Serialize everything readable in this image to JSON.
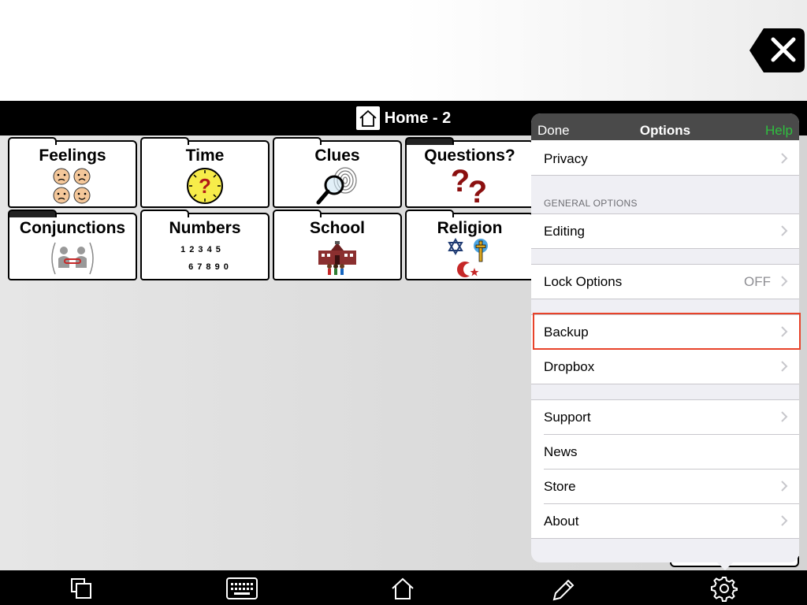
{
  "header": {
    "board_title": "Home - 2"
  },
  "tiles": [
    {
      "label": "Feelings",
      "icon": "faces-icon"
    },
    {
      "label": "Time",
      "icon": "clock-question-icon"
    },
    {
      "label": "Clues",
      "icon": "magnifier-fingerprint-icon"
    },
    {
      "label": "Questions?",
      "icon": "question-marks-icon"
    },
    {
      "label": "Conjunctions",
      "icon": "linked-people-icon"
    },
    {
      "label": "Numbers",
      "icon": "numbers-icon",
      "numbers_line1": "1 2 3 4 5",
      "numbers_line2": "6 7 8 9 0"
    },
    {
      "label": "School",
      "icon": "school-building-icon"
    },
    {
      "label": "Religion",
      "icon": "religion-symbols-icon"
    }
  ],
  "options": {
    "done_label": "Done",
    "title": "Options",
    "help_label": "Help",
    "privacy": "Privacy",
    "general_header": "GENERAL OPTIONS",
    "editing": "Editing",
    "lock_options": "Lock Options",
    "lock_value": "OFF",
    "backup": "Backup",
    "dropbox": "Dropbox",
    "support": "Support",
    "news": "News",
    "store": "Store",
    "about": "About"
  },
  "toolbar": [
    "copy-icon",
    "keyboard-icon",
    "home-icon",
    "pencil-icon",
    "gear-icon"
  ],
  "colors": {
    "accent_help": "#2fbf3f",
    "highlight": "#e8432a",
    "popover_header": "#4a4a4a"
  }
}
